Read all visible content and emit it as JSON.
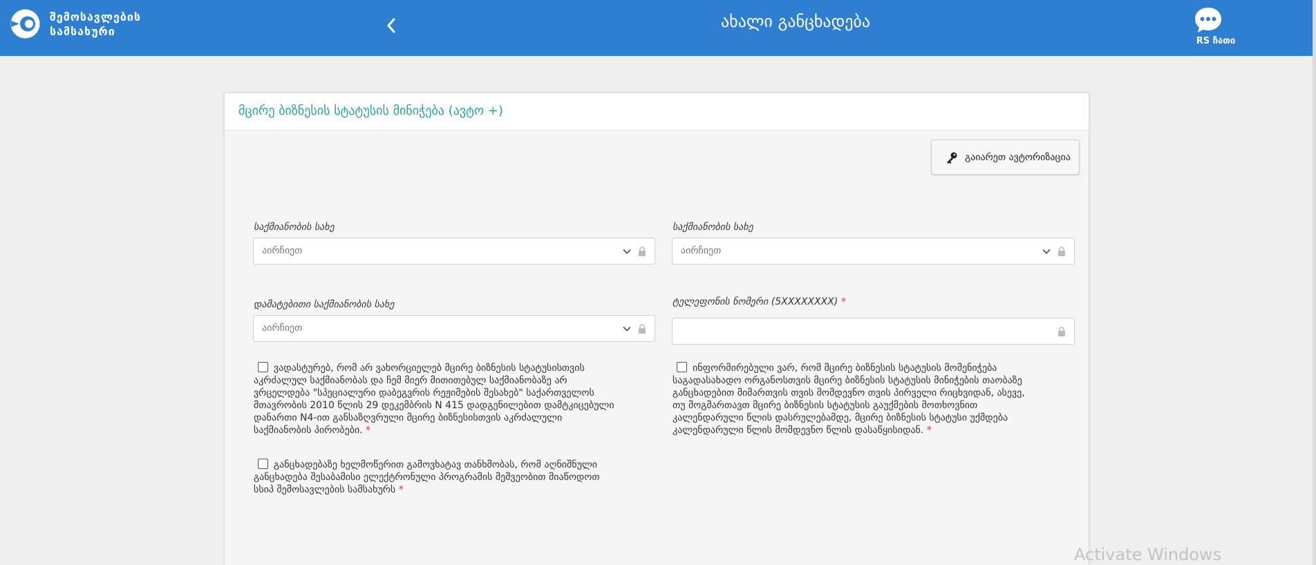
{
  "header": {
    "logo_line1": "შემოსავლების",
    "logo_line2": "სამსახური",
    "title": "ახალი განცხადება",
    "chat_label": "RS ჩათი",
    "color": "#2e7fd2"
  },
  "card": {
    "title": "მცირე ბიზნესის სტატუსის მინიჭება (ავტო +)",
    "title_color": "#27a88a",
    "auth_button": "გაიარეთ ავტორიზაცია"
  },
  "fields": {
    "activity1_label": "საქმიანობის სახე",
    "activity1_placeholder": "აირჩიეთ",
    "activity2_label": "საქმიანობის სახე",
    "activity2_placeholder": "აირჩიეთ",
    "additional_label": "დამატებითი საქმიანობის სახე",
    "additional_placeholder": "აირჩიეთ",
    "phone_label": "ტელეფონის ნომერი (5XXXXXXXX)",
    "required_mark": "*"
  },
  "checkboxes": {
    "c1_line1": "ვადასტურებ, რომ არ ვახორციელებ მცირე ბიზნესის სტატუსისთვის",
    "c1_line2": "აკრძალულ საქმიანობას და ჩემ მიერ მითითებულ საქმიანობაზე არ",
    "c1_line3": "ვრცელდება \"სპეციალური დაბეგვრის რეჟიმების შესახებ\" საქართველოს",
    "c1_line4": "მთავრობის 2010 წლის 29 დეკემბრის N 415 დადგენილებით დამტკიცებული",
    "c1_line5": "დანართი N4-ით განსაზღვრული მცირე ბიზნესისთვის აკრძალული",
    "c1_line6": "საქმიანობის პირობები.",
    "c2_line1": "ინფორმირებული ვარ, რომ მცირე ბიზნესის სტატუსის მომენიჭება",
    "c2_line2": "საგადასახადო ორგანოსთვის მცირე ბიზნესის სტატუსის მინიჭების თაობაზე",
    "c2_line3": "განცხადებით მიმართვის თვის მომდევნო თვის პირველი რიცხვიდან, ასევე,",
    "c2_line4": "თუ მოგმართავთ მცირე ბიზნესის სტატუსის გაუქმების მოთხოვნით",
    "c2_line5": "კალენდარული წლის დასრულებამდე, მცირე ბიზნესის სტატუსი უქმდება",
    "c2_line6": "კალენდარული წლის მომდევნო წლის დასაწყისიდან.",
    "c3_line1": "განცხადებაზე ხელმოწერით გამოვხატავ თანხმობას, რომ აღნიშნული",
    "c3_line2": "განცხადება შესაბამისი ელექტრონული პროგრამის მეშვეობით მიაწოდოთ",
    "c3_line3": "სსიპ შემოსავლების სამსახურს"
  },
  "watermark": "Activate Windows",
  "icons": [
    "logo-icon",
    "chevron-left-icon",
    "chat-bubble-icon",
    "key-icon",
    "chevron-down-icon",
    "lock-icon"
  ]
}
